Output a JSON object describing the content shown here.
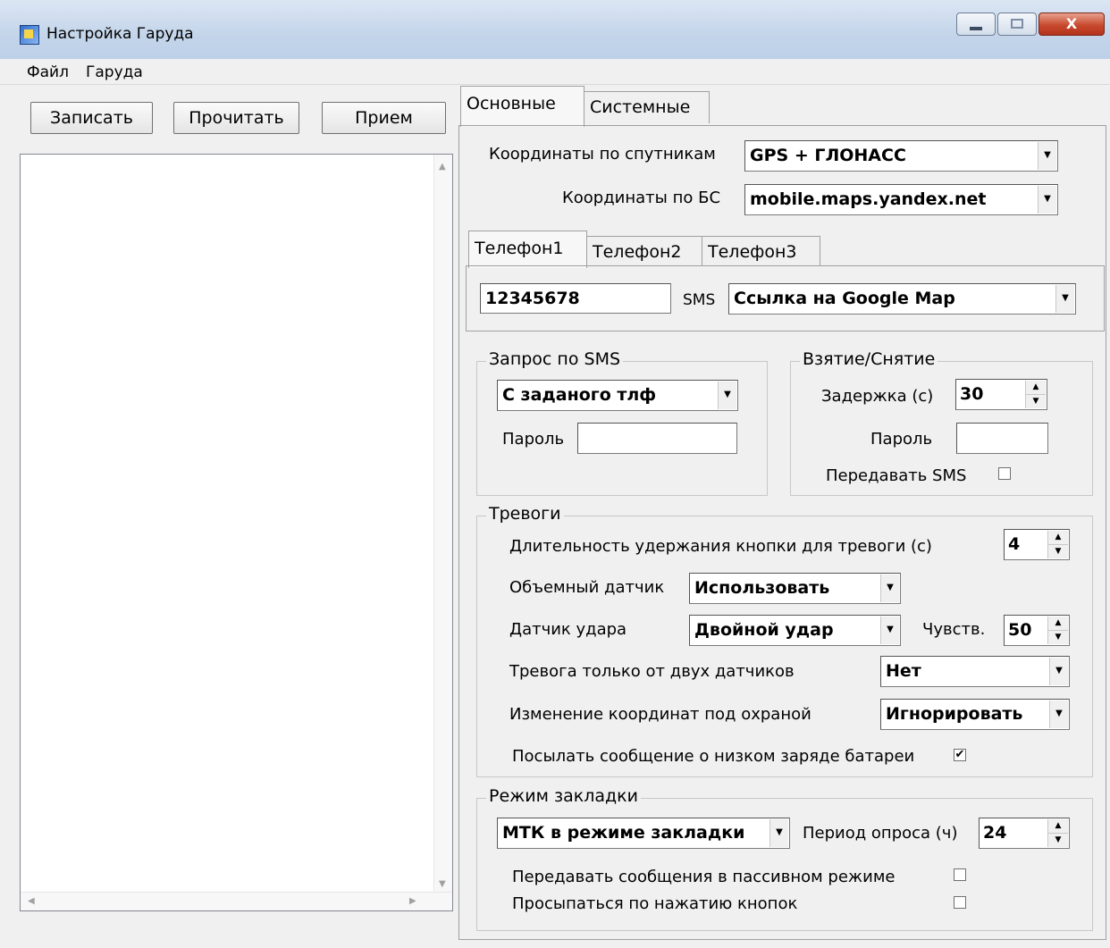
{
  "window": {
    "title": "Настройка Гаруда",
    "close_glyph": "X"
  },
  "menu": {
    "file": "Файл",
    "garuda": "Гаруда"
  },
  "toolbar": {
    "write": "Записать",
    "read": "Прочитать",
    "receive": "Прием"
  },
  "tabs": {
    "main": "Основные",
    "system": "Системные"
  },
  "coords": {
    "satellite_label": "Координаты по спутникам",
    "satellite_value": "GPS + ГЛОНАСС",
    "bs_label": "Координаты по БС",
    "bs_value": "mobile.maps.yandex.net"
  },
  "phone_tabs": {
    "phone1": "Телефон1",
    "phone2": "Телефон2",
    "phone3": "Телефон3"
  },
  "phone": {
    "number": "12345678",
    "sms_label": "SMS",
    "sms_value": "Ссылка на Google Map"
  },
  "sms_request": {
    "title": "Запрос по SMS",
    "mode_value": "С заданого тлф",
    "password_label": "Пароль",
    "password_value": ""
  },
  "arming": {
    "title": "Взятие/Снятие",
    "delay_label": "Задержка (с)",
    "delay_value": "30",
    "password_label": "Пароль",
    "password_value": "",
    "send_sms_label": "Передавать SMS",
    "send_sms_checked": false
  },
  "alarms": {
    "title": "Тревоги",
    "hold_label": "Длительность удержания кнопки для тревоги (с)",
    "hold_value": "4",
    "volume_label": "Объемный датчик",
    "volume_value": "Использовать",
    "shock_label": "Датчик удара",
    "shock_value": "Двойной удар",
    "sens_label": "Чувств.",
    "sens_value": "50",
    "two_sensors_label": "Тревога только от двух датчиков",
    "two_sensors_value": "Нет",
    "coord_change_label": "Изменение координат под охраной",
    "coord_change_value": "Игнорировать",
    "low_battery_label": "Посылать сообщение о низком заряде батареи",
    "low_battery_checked": true
  },
  "bookmark": {
    "title": "Режим закладки",
    "mode_value": "МТК в режиме закладки",
    "period_label": "Период опроса (ч)",
    "period_value": "24",
    "passive_label": "Передавать сообщения в пассивном режиме",
    "passive_checked": false,
    "wake_label": "Просыпаться по нажатию кнопок",
    "wake_checked": false
  },
  "glyphs": {
    "dropdown": "▼",
    "spin_up": "▲",
    "spin_down": "▼",
    "check": "✔",
    "scroll_up": "▲",
    "scroll_down": "▼",
    "scroll_left": "◀",
    "scroll_right": "▶"
  }
}
